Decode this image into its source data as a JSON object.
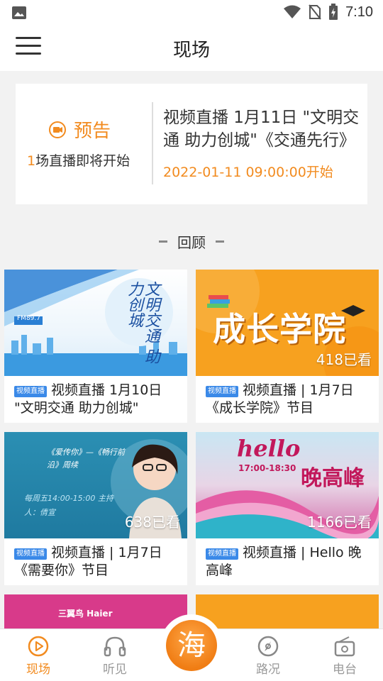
{
  "status_bar": {
    "time": "7:10"
  },
  "header": {
    "title": "现场"
  },
  "preview": {
    "badge": "预告",
    "count": "1",
    "count_suffix": "场直播即将开始",
    "title": "视频直播 1月11日 \"文明交通 助力创城\"《交通先行》",
    "time": "2022-01-11 09:00:00开始"
  },
  "section": {
    "label": "回顾"
  },
  "cards": [
    {
      "tag": "视频直播",
      "title": "视频直播 1月10日 \"文明交通 助力创城\"",
      "views": "",
      "thumb_text": "文明交通 助力创城",
      "thumb_small": "FM89.7"
    },
    {
      "tag": "视频直播",
      "title": "视频直播 | 1月7日《成长学院》节目",
      "views": "418已看",
      "thumb_text": "成长学院"
    },
    {
      "tag": "视频直播",
      "title": "视频直播 | 1月7日《需要你》节目",
      "views": "638已看",
      "thumb_text": "《爱传你》—《畅行前沿》周续",
      "thumb_small": "每周五14:00-15:00 主持人：倩宣"
    },
    {
      "tag": "视频直播",
      "title": "视频直播 | Hello 晚高峰",
      "views": "1166已看",
      "thumb_text": "晚高峰",
      "thumb_hello": "hello",
      "thumb_small": "17:00-18:30"
    }
  ],
  "partial_cards": [
    {
      "thumb_text": "三翼鸟  Haier"
    },
    {
      "thumb_text": ""
    }
  ],
  "bottom_nav": [
    {
      "label": "现场",
      "icon": "play-circle-icon",
      "active": true
    },
    {
      "label": "听见",
      "icon": "headphones-icon",
      "active": false
    },
    {
      "label": "海",
      "icon": "center-logo",
      "active": false
    },
    {
      "label": "路况",
      "icon": "compass-icon",
      "active": false
    },
    {
      "label": "电台",
      "icon": "radio-icon",
      "active": false
    }
  ],
  "colors": {
    "accent": "#f28b1f",
    "tag_blue": "#3a89e8"
  }
}
